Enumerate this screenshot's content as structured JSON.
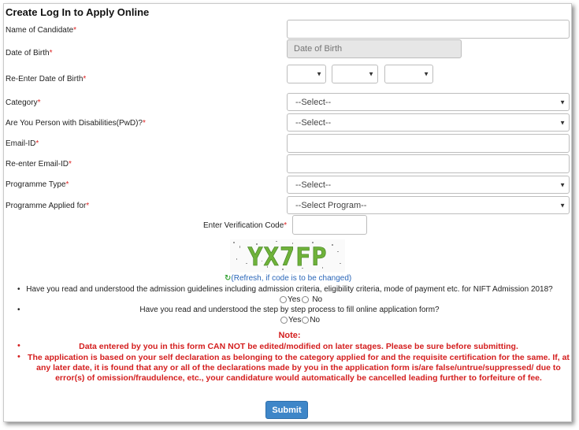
{
  "form": {
    "title": "Create Log In to Apply Online",
    "required_marker": "*",
    "fields": {
      "name": {
        "label": "Name of Candidate"
      },
      "dob": {
        "label": "Date of Birth",
        "placeholder": "Date of Birth"
      },
      "dob_reenter": {
        "label": "Re-Enter Date of Birth"
      },
      "category": {
        "label": "Category",
        "selected": "--Select--"
      },
      "pwd": {
        "label": "Are You Person with Disabilities(PwD)?",
        "selected": "--Select--"
      },
      "email": {
        "label": "Email-ID"
      },
      "email_reenter": {
        "label": "Re-enter Email-ID"
      },
      "programme_type": {
        "label": "Programme Type",
        "selected": "--Select--"
      },
      "programme_applied": {
        "label": "Programme Applied for",
        "selected": "--Select Program--"
      }
    },
    "verification": {
      "label": "Enter Verification Code",
      "captcha_text": "YX7FP",
      "refresh_text": "(Refresh, if code is to be changed)"
    },
    "questions": [
      {
        "text": "Have you read and understood the admission guidelines including admission criteria, eligibility criteria, mode of payment etc. for NIFT Admission 2018?",
        "yes": "Yes",
        "no": "No"
      },
      {
        "text": "Have you read and understood the step by step process to fill online application form?",
        "yes": "Yes",
        "no": "No"
      }
    ],
    "note_title": "Note:",
    "notes": [
      "Data entered by you in this form CAN NOT be edited/modified on later stages. Please be sure before submitting.",
      "The application is based on your self declaration as belonging to the category applied for and the requisite certification for the same. If, at any later date, it is found that any or all of the declarations made by you in the application form is/are false/untrue/suppressed/ due to error(s) of omission/fraudulence, etc., your candidature would automatically be cancelled leading further to forfeiture of fee."
    ],
    "submit_label": "Submit"
  },
  "colors": {
    "required": "#dd2222",
    "note_text": "#d41e1e",
    "submit_bg": "#3e86c8",
    "link": "#2a66b8",
    "captcha": "#5aa82a"
  }
}
